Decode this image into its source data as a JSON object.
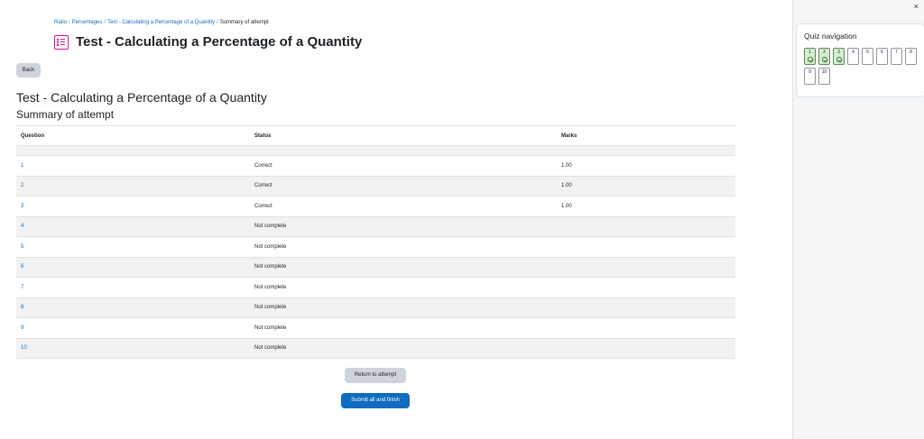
{
  "breadcrumb": {
    "items": [
      "Ratio",
      "Percentages",
      "Test - Calculating a Percentage of a Quantity"
    ],
    "current": "Summary of attempt",
    "separator": "/"
  },
  "page_title": "Test - Calculating a Percentage of a Quantity",
  "back_label": "Back",
  "quiz_heading": "Test - Calculating a Percentage of a Quantity",
  "summary_heading": "Summary of attempt",
  "table": {
    "headers": [
      "Question",
      "Status",
      "Marks"
    ],
    "rows": [
      {
        "q": "1",
        "status": "Correct",
        "marks": "1.00"
      },
      {
        "q": "2",
        "status": "Correct",
        "marks": "1.00"
      },
      {
        "q": "3",
        "status": "Correct",
        "marks": "1.00"
      },
      {
        "q": "4",
        "status": "Not complete",
        "marks": ""
      },
      {
        "q": "5",
        "status": "Not complete",
        "marks": ""
      },
      {
        "q": "6",
        "status": "Not complete",
        "marks": ""
      },
      {
        "q": "7",
        "status": "Not complete",
        "marks": ""
      },
      {
        "q": "8",
        "status": "Not complete",
        "marks": ""
      },
      {
        "q": "9",
        "status": "Not complete",
        "marks": ""
      },
      {
        "q": "10",
        "status": "Not complete",
        "marks": ""
      }
    ]
  },
  "return_label": "Return to attempt",
  "submit_label": "Submit all and finish",
  "drawer": {
    "close_glyph": "×",
    "nav_title": "Quiz navigation",
    "questions": [
      {
        "n": "1",
        "answered": true
      },
      {
        "n": "2",
        "answered": true
      },
      {
        "n": "3",
        "answered": true
      },
      {
        "n": "4",
        "answered": false
      },
      {
        "n": "5",
        "answered": false
      },
      {
        "n": "6",
        "answered": false
      },
      {
        "n": "7",
        "answered": false
      },
      {
        "n": "8",
        "answered": false
      },
      {
        "n": "9",
        "answered": false
      },
      {
        "n": "10",
        "answered": false
      }
    ]
  },
  "colors": {
    "link": "#0f6cbf",
    "primary": "#0f6cbf",
    "accent_icon": "#e60c8f",
    "answered": "#d7ecd2"
  }
}
